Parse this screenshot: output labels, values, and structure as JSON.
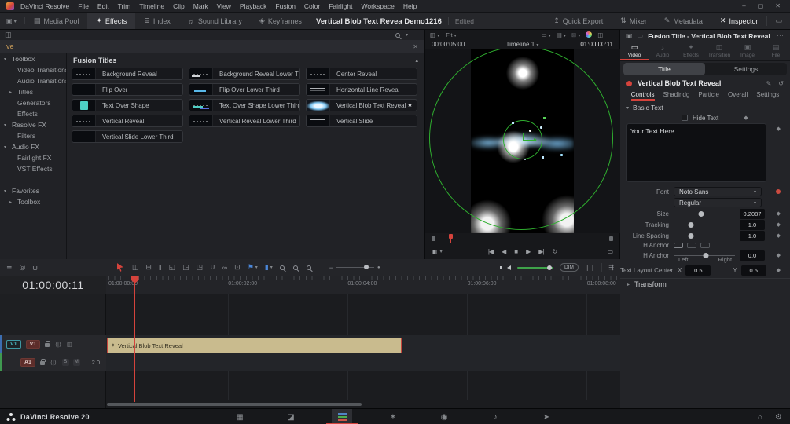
{
  "glyphs": {
    "chev_down": "▾",
    "chev_up": "▴",
    "chev_right": "▸",
    "dots": "⋯",
    "star": "★",
    "diamond": "◆",
    "close": "✕",
    "minimize": "–",
    "maximize": "▢",
    "panel": "▣",
    "display": "▭",
    "film": "▥",
    "box": "▭",
    "gallery": "▤",
    "wipe": "⊠",
    "split": "◫",
    "clipcam": "▣",
    "loopbox": "▭",
    "pen": "✎",
    "reset": "↺",
    "fusion_clip": "✦",
    "home": "⌂",
    "settings": "⚙"
  },
  "menu_bar": {
    "items": [
      "DaVinci Resolve",
      "File",
      "Edit",
      "Trim",
      "Timeline",
      "Clip",
      "Mark",
      "View",
      "Playback",
      "Fusion",
      "Color",
      "Fairlight",
      "Workspace",
      "Help"
    ]
  },
  "top_toolbar": {
    "title": "Vertical Blob Text Revea Demo1216",
    "status": "Edited",
    "left_buttons": [
      {
        "name": "media-pool-button",
        "glyph": "▤",
        "label": "Media Pool"
      },
      {
        "name": "effects-button",
        "glyph": "✦",
        "label": "Effects",
        "active": true
      },
      {
        "name": "index-button",
        "glyph": "≣",
        "label": "Index"
      },
      {
        "name": "sound-library-button",
        "glyph": "♬",
        "label": "Sound Library"
      },
      {
        "name": "keyframes-button",
        "glyph": "◈",
        "label": "Keyframes"
      }
    ],
    "right_buttons": [
      {
        "name": "quick-export-button",
        "glyph": "↥",
        "label": "Quick Export"
      },
      {
        "name": "mixer-button",
        "glyph": "⇅",
        "label": "Mixer"
      },
      {
        "name": "metadata-button",
        "glyph": "✎",
        "label": "Metadata"
      },
      {
        "name": "inspector-button",
        "glyph": "✕",
        "label": "Inspector",
        "active": true
      }
    ]
  },
  "effects_panel": {
    "search_value": "ve",
    "list_header": "Fusion Titles",
    "tree": [
      {
        "label": "Toolbox",
        "arrow": "▾",
        "kind": "root",
        "name": "tree-toolbox"
      },
      {
        "label": "Video Transitions",
        "kind": "child",
        "name": "tree-video-transitions"
      },
      {
        "label": "Audio Transitions",
        "kind": "child",
        "name": "tree-audio-transitions"
      },
      {
        "label": "Titles",
        "arrow": "▸",
        "kind": "child",
        "active": true,
        "name": "tree-titles"
      },
      {
        "label": "Generators",
        "kind": "child",
        "name": "tree-generators"
      },
      {
        "label": "Effects",
        "kind": "child",
        "name": "tree-effects"
      },
      {
        "label": "Resolve FX",
        "arrow": "▾",
        "kind": "root",
        "name": "tree-resolve-fx"
      },
      {
        "label": "Filters",
        "kind": "child",
        "name": "tree-filters"
      },
      {
        "label": "Audio FX",
        "arrow": "▾",
        "kind": "root",
        "name": "tree-audio-fx"
      },
      {
        "label": "Fairlight FX",
        "kind": "child",
        "name": "tree-fairlight-fx"
      },
      {
        "label": "VST Effects",
        "kind": "child",
        "name": "tree-vst-effects"
      },
      {
        "divider": true
      },
      {
        "label": "Favorites",
        "arrow": "▾",
        "kind": "root",
        "name": "tree-favorites"
      },
      {
        "label": "Toolbox",
        "arrow": "▸",
        "kind": "child",
        "name": "tree-favorites-toolbox"
      }
    ],
    "cards": [
      {
        "label": "Background Reveal",
        "thumb": "th-dash"
      },
      {
        "label": "Background Reveal Lower Third",
        "thumb": "th-dash-bright"
      },
      {
        "label": "Center Reveal",
        "thumb": "th-dash"
      },
      {
        "label": "Flip Over",
        "thumb": "th-dash"
      },
      {
        "label": "Flip Over Lower Third",
        "thumb": "th-cyan"
      },
      {
        "label": "Horizontal Line Reveal",
        "thumb": "th-text"
      },
      {
        "label": "Text Over Shape",
        "thumb": "th-teal"
      },
      {
        "label": "Text Over Shape Lower Third",
        "thumb": "th-teal-lines"
      },
      {
        "label": "Vertical Blob Text Reveal",
        "thumb": "th-blob",
        "starred": true
      },
      {
        "label": "Vertical Reveal",
        "thumb": "th-dash"
      },
      {
        "label": "Vertical Reveal Lower Third",
        "thumb": "th-dash"
      },
      {
        "label": "Vertical Slide",
        "thumb": "th-text"
      },
      {
        "label": "Vertical Slide Lower Third",
        "thumb": "th-dash"
      }
    ]
  },
  "viewer": {
    "zoom_label": "Fit",
    "tc_left": "00:00:05:00",
    "timeline_name": "Timeline 1",
    "tc_right": "01:00:00:11",
    "transport": [
      {
        "name": "first-frame-button",
        "glyph": "|◀"
      },
      {
        "name": "play-reverse-button",
        "glyph": "◀"
      },
      {
        "name": "stop-button",
        "glyph": "■"
      },
      {
        "name": "play-button",
        "glyph": "▶"
      },
      {
        "name": "last-frame-button",
        "glyph": "▶|"
      },
      {
        "name": "loop-button",
        "glyph": "↻"
      }
    ]
  },
  "inspector": {
    "title": "Fusion Title - Vertical Blob Text Reveal",
    "tabs": [
      {
        "name": "inspector-tab-video",
        "glyph": "▭",
        "label": "Video",
        "active": true
      },
      {
        "name": "inspector-tab-audio",
        "glyph": "♪",
        "label": "Audio"
      },
      {
        "name": "inspector-tab-effects",
        "glyph": "✦",
        "label": "Effects"
      },
      {
        "name": "inspector-tab-transition",
        "glyph": "◫",
        "label": "Transition"
      },
      {
        "name": "inspector-tab-image",
        "glyph": "▣",
        "label": "Image"
      },
      {
        "name": "inspector-tab-file",
        "glyph": "▤",
        "label": "File"
      }
    ],
    "view_tabs": [
      {
        "name": "title-view-tab",
        "label": "Title",
        "active": true
      },
      {
        "name": "settings-view-tab",
        "label": "Settings"
      }
    ],
    "node_name": "Vertical Blob Text Reveal",
    "control_tabs": [
      {
        "name": "controls-tab",
        "label": "Controls",
        "active": true
      },
      {
        "name": "shading-tab",
        "label": "Shadindg"
      },
      {
        "name": "particle-tab",
        "label": "Particle"
      },
      {
        "name": "overall-tab",
        "label": "Overall"
      },
      {
        "name": "settings-tab",
        "label": "Settings"
      }
    ],
    "section": "Basic Text",
    "hide_text_label": "Hide Text",
    "text_value": "Your Text Here",
    "font_label": "Font",
    "font_value": "Noto Sans",
    "font_style": "Regular",
    "sliders": [
      {
        "label": "Size",
        "value": "0.2087",
        "pct": 45
      },
      {
        "label": "Tracking",
        "value": "1.0",
        "pct": 28
      },
      {
        "label": "Line Spacing",
        "value": "1.0",
        "pct": 28
      }
    ],
    "anchor_buttons_label": "H Anchor",
    "anchor_slider_label": "H Anchor",
    "anchor_value": "0.0",
    "anchor_pct": 52,
    "anchor_left": "Left",
    "anchor_right": "Right",
    "layout_label": "Text Layout Center",
    "x_label": "X",
    "x_value": "0.5",
    "y_label": "Y",
    "y_value": "0.5",
    "transform_label": "Transform"
  },
  "timeline_toolbar": {
    "dim": "DIM",
    "tools": [
      {
        "name": "timeline-view-options-icon",
        "glyph": "≣"
      },
      {
        "name": "stacked-timelines-icon",
        "glyph": "◎"
      },
      {
        "name": "mic-icon",
        "glyph": "ψ"
      },
      {
        "name": "selection-mode-icon",
        "glyph": "",
        "cls": "tool-cursor",
        "shape": true
      },
      {
        "name": "trim-edit-mode-icon",
        "glyph": "◫"
      },
      {
        "name": "razor-edit-icon",
        "glyph": "⊟"
      },
      {
        "name": "dynamic-trim-icon",
        "glyph": "‖"
      },
      {
        "name": "insert-clip-icon",
        "glyph": "◱",
        "gap": true
      },
      {
        "name": "overwrite-clip-icon",
        "glyph": "◲"
      },
      {
        "name": "replace-clip-icon",
        "glyph": "◳"
      },
      {
        "name": "snapping-icon",
        "glyph": "∪",
        "gap": true
      },
      {
        "name": "linked-selection-icon",
        "glyph": "∞"
      },
      {
        "name": "position-lock-icon",
        "glyph": "⊡"
      },
      {
        "name": "flag-icon",
        "glyph": "⚑",
        "cls": "tool-blue",
        "chev": true,
        "gap": true
      },
      {
        "name": "marker-icon",
        "glyph": "▮",
        "cls": "tool-blue",
        "chev": true
      },
      {
        "name": "zoom-full-extent-icon",
        "glyph": "",
        "cls": "tool-mag",
        "shape": true,
        "gap": true
      },
      {
        "name": "zoom-detail-icon",
        "glyph": "",
        "cls": "tool-mag",
        "shape": true
      },
      {
        "name": "zoom-custom-icon",
        "glyph": "",
        "cls": "tool-mag",
        "shape": true
      }
    ]
  },
  "timeline": {
    "timecode": "01:00:00:11",
    "ruler": [
      "01:00:00:00",
      "01:00:02:00",
      "01:00:04:00",
      "01:00:06:00",
      "01:00:08:00"
    ],
    "clip_name": "Vertical Blob Text Reveal",
    "v1_dest": "V1",
    "v1_badge": "V1",
    "a1_badge": "A1",
    "solo": "S",
    "mute": "M",
    "channels": "2.0"
  },
  "bottom_bar": {
    "brand": "DaVinci Resolve 20",
    "pages": [
      {
        "name": "page-media",
        "glyph": "▦",
        "cls": "pg-media"
      },
      {
        "name": "page-cut",
        "glyph": "◪",
        "cls": "pg-cut"
      },
      {
        "name": "page-edit",
        "glyph": "",
        "cls": "pg-edit",
        "active": true
      },
      {
        "name": "page-fusion",
        "glyph": "✶",
        "cls": "pg-fusion"
      },
      {
        "name": "page-color",
        "glyph": "◉",
        "cls": "pg-color"
      },
      {
        "name": "page-fairlight",
        "glyph": "♪",
        "cls": "pg-fairlight"
      },
      {
        "name": "page-deliver",
        "glyph": "➤",
        "cls": "pg-deliver"
      }
    ]
  }
}
